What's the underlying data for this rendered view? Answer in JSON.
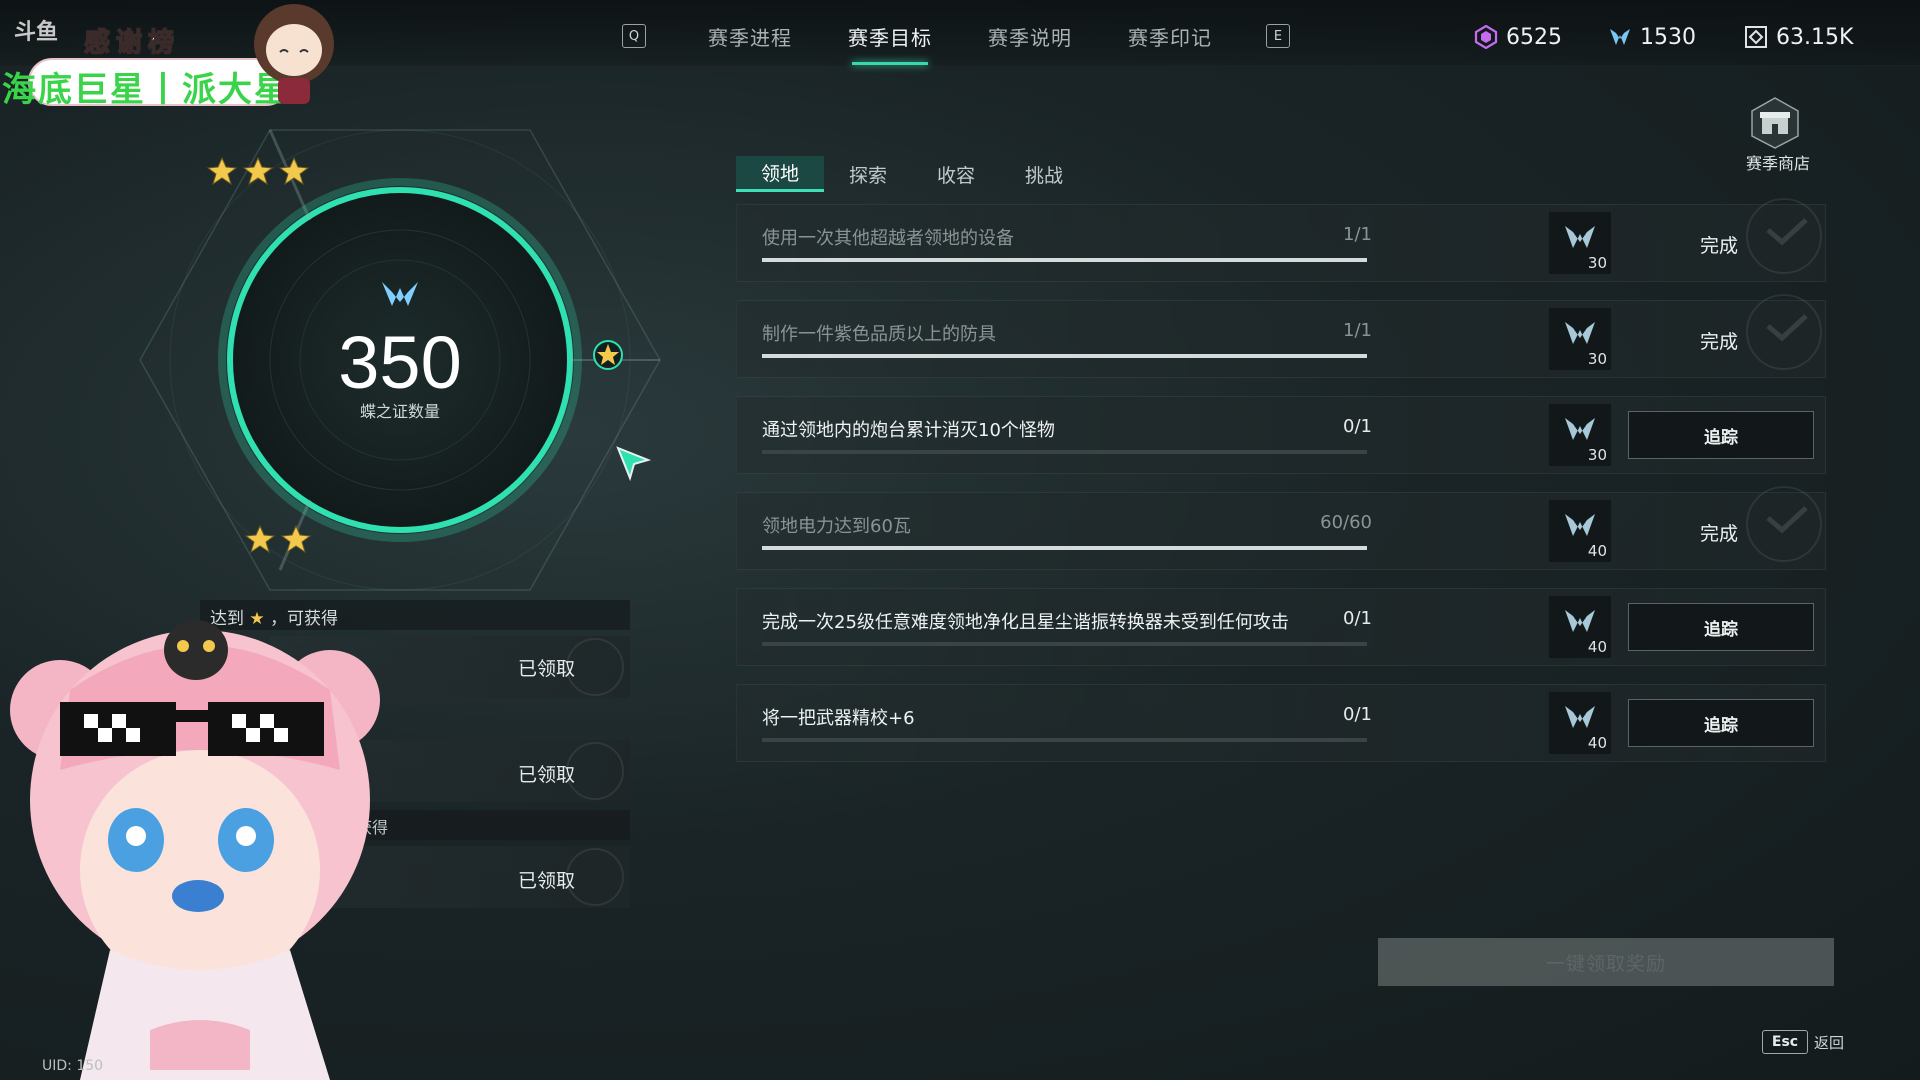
{
  "top_nav": {
    "left_key": "Q",
    "right_key": "E",
    "tabs": [
      {
        "label": "赛季进程",
        "active": false
      },
      {
        "label": "赛季目标",
        "active": true
      },
      {
        "label": "赛季说明",
        "active": false
      },
      {
        "label": "赛季印记",
        "active": false
      }
    ]
  },
  "currencies": [
    {
      "icon": "crystal-icon",
      "value": "6525"
    },
    {
      "icon": "butterfly-mark-icon",
      "value": "1530"
    },
    {
      "icon": "energy-cube-icon",
      "value": "63.15K"
    }
  ],
  "overlay": {
    "thanks_title": "感谢榜",
    "thanks_names": "海底巨星丨派大星",
    "brand": "斗鱼"
  },
  "gauge": {
    "value": "350",
    "label": "蝶之证数量",
    "accent": "#2fe0b0"
  },
  "rewards_panel": {
    "reach_text": "达到",
    "reach_suffix": "，可获得",
    "rows": [
      {
        "status": "已领取"
      },
      {
        "status": "已领取"
      },
      {
        "status": "已领取"
      }
    ],
    "partial_text": "获得"
  },
  "category_tabs": [
    {
      "label": "领地",
      "active": true
    },
    {
      "label": "探索",
      "active": false
    },
    {
      "label": "收容",
      "active": false
    },
    {
      "label": "挑战",
      "active": false
    }
  ],
  "shop": {
    "label": "赛季商店"
  },
  "tasks": [
    {
      "title": "使用一次其他超越者领地的设备",
      "progress": "1/1",
      "progress_fraction": 1.0,
      "reward": "30",
      "state": "done",
      "status": "完成"
    },
    {
      "title": "制作一件紫色品质以上的防具",
      "progress": "1/1",
      "progress_fraction": 1.0,
      "reward": "30",
      "state": "done",
      "status": "完成"
    },
    {
      "title": "通过领地内的炮台累计消灭10个怪物",
      "progress": "0/1",
      "progress_fraction": 0.0,
      "reward": "30",
      "state": "track",
      "status": "追踪"
    },
    {
      "title": "领地电力达到60瓦",
      "progress": "60/60",
      "progress_fraction": 1.0,
      "reward": "40",
      "state": "done",
      "status": "完成"
    },
    {
      "title": "完成一次25级任意难度领地净化且星尘谐振转换器未受到任何攻击",
      "progress": "0/1",
      "progress_fraction": 0.0,
      "reward": "40",
      "state": "track",
      "status": "追踪"
    },
    {
      "title": "将一把武器精校+6",
      "progress": "0/1",
      "progress_fraction": 0.0,
      "reward": "40",
      "state": "track",
      "status": "追踪"
    }
  ],
  "claim_all_label": "一键领取奖励",
  "footer": {
    "esc_key": "Esc",
    "esc_label": "返回",
    "uid": "UID: 150"
  }
}
